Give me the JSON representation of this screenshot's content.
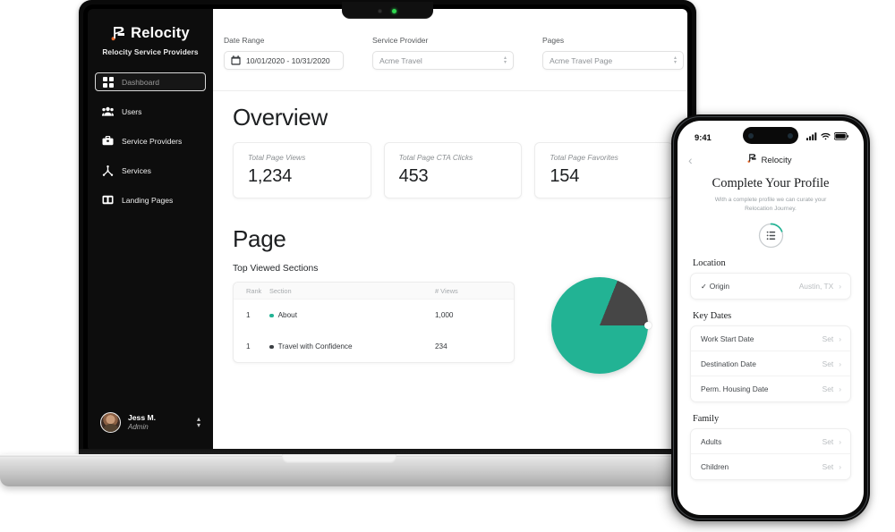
{
  "colors": {
    "accent_green": "#22b394",
    "slice_dark": "#464646",
    "brand_orange": "#e8682a",
    "sidebar_bg": "#0d0d0d"
  },
  "laptop": {
    "sidebar": {
      "brand_name": "Relocity",
      "brand_subtitle": "Relocity Service Providers",
      "logo_icon": "relocity-r-mark",
      "items": [
        {
          "label": "Dashboard",
          "icon": "grid-icon",
          "active": true
        },
        {
          "label": "Users",
          "icon": "users-icon",
          "active": false
        },
        {
          "label": "Service Providers",
          "icon": "briefcase-icon",
          "active": false
        },
        {
          "label": "Services",
          "icon": "hub-icon",
          "active": false
        },
        {
          "label": "Landing Pages",
          "icon": "columns-icon",
          "active": false
        }
      ],
      "user": {
        "name": "Jess M.",
        "role": "Admin",
        "avatar_icon": "user-avatar",
        "selector_icon": "up-down-chevron-icon"
      }
    },
    "filters": [
      {
        "label": "Date Range",
        "value": "10/01/2020 - 10/31/2020",
        "icon": "calendar-icon",
        "type": "date"
      },
      {
        "label": "Service Provider",
        "value": "Acme Travel",
        "icon": "chevron-updown-icon",
        "type": "select"
      },
      {
        "label": "Pages",
        "value": "Acme Travel Page",
        "icon": "chevron-updown-icon",
        "type": "select"
      }
    ],
    "overview": {
      "heading": "Overview",
      "cards": [
        {
          "label": "Total Page Views",
          "value": "1,234"
        },
        {
          "label": "Total Page CTA Clicks",
          "value": "453"
        },
        {
          "label": "Total Page Favorites",
          "value": "154"
        }
      ]
    },
    "page_section": {
      "heading": "Page",
      "subheading": "Top Viewed Sections",
      "table": {
        "columns": [
          "Rank",
          "Section",
          "# Views"
        ],
        "rows": [
          {
            "rank": "1",
            "section": "About",
            "views": "1,000",
            "dot": "#22b394"
          },
          {
            "rank": "1",
            "section": "Travel with Confidence",
            "views": "234",
            "dot": "#3b3f43"
          }
        ]
      }
    }
  },
  "chart_data": {
    "type": "pie",
    "title": "Top Viewed Sections",
    "labels": [
      "About",
      "Travel with Confidence"
    ],
    "values": [
      1000,
      234
    ],
    "percentages": [
      81,
      19
    ],
    "colors": [
      "#22b394",
      "#464646"
    ],
    "legend": "inline-with-table",
    "note": "Pie partially occluded by phone mockup"
  },
  "phone": {
    "status": {
      "time": "9:41",
      "signal_icon": "cellular-signal-icon",
      "wifi_icon": "wifi-icon",
      "battery_icon": "battery-icon"
    },
    "nav": {
      "back_icon": "chevron-left-icon",
      "brand_name": "Relocity",
      "logo_icon": "relocity-r-mark"
    },
    "title": "Complete Your Profile",
    "subtitle": "With a complete profile we can curate your Relocation Journey.",
    "progress_icon": "checklist-ring-icon",
    "sections": [
      {
        "heading": "Location",
        "rows": [
          {
            "label": "Origin",
            "value": "Austin, TX",
            "checked": true,
            "chevron": "›"
          }
        ]
      },
      {
        "heading": "Key Dates",
        "rows": [
          {
            "label": "Work Start Date",
            "value": "Set",
            "checked": false,
            "chevron": "›"
          },
          {
            "label": "Destination Date",
            "value": "Set",
            "checked": false,
            "chevron": "›"
          },
          {
            "label": "Perm. Housing Date",
            "value": "Set",
            "checked": false,
            "chevron": "›"
          }
        ]
      },
      {
        "heading": "Family",
        "rows": [
          {
            "label": "Adults",
            "value": "Set",
            "checked": false,
            "chevron": "›"
          },
          {
            "label": "Children",
            "value": "Set",
            "checked": false,
            "chevron": "›"
          }
        ]
      }
    ]
  }
}
